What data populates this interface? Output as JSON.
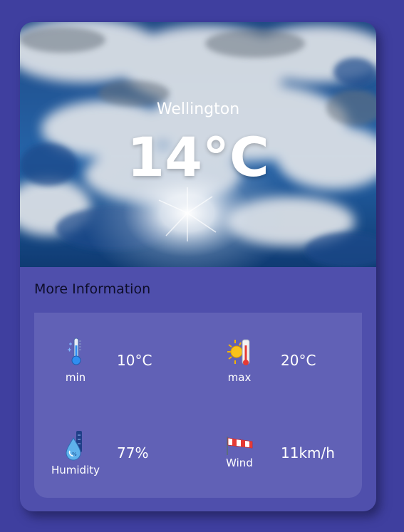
{
  "weather": {
    "city": "Wellington",
    "temperature": "14°C"
  },
  "details": {
    "title": "More Information",
    "stats": [
      {
        "icon": "thermometer-cold-icon",
        "label": "min",
        "value": "10°C"
      },
      {
        "icon": "sun-thermometer-icon",
        "label": "max",
        "value": "20°C"
      },
      {
        "icon": "humidity-drop-icon",
        "label": "Humidity",
        "value": "77%"
      },
      {
        "icon": "windsock-icon",
        "label": "Wind",
        "value": "11km/h"
      }
    ]
  },
  "colors": {
    "background": "#3f3f9f",
    "card": "#4f4fac",
    "panel": "#6161b6"
  }
}
